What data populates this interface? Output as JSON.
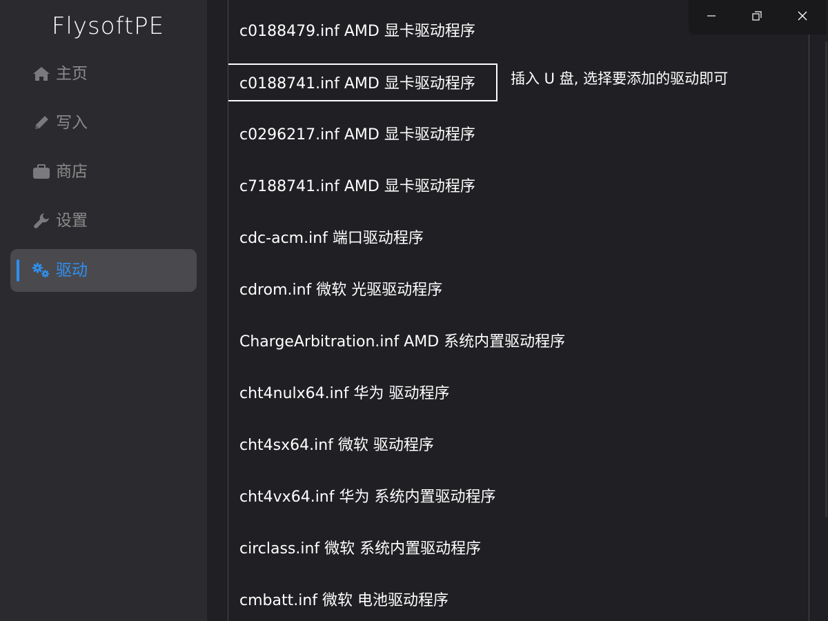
{
  "app": {
    "title": "FlysoftPE"
  },
  "sidebar": {
    "items": [
      {
        "label": "主页",
        "icon": "home-icon"
      },
      {
        "label": "写入",
        "icon": "pencil-icon"
      },
      {
        "label": "商店",
        "icon": "briefcase-icon"
      },
      {
        "label": "设置",
        "icon": "wrench-icon"
      },
      {
        "label": "驱动",
        "icon": "gears-icon",
        "active": true
      }
    ],
    "active_color": "#2f8ff0"
  },
  "drivers": {
    "items": [
      "c0188479.inf AMD 显卡驱动程序",
      "c0188741.inf AMD 显卡驱动程序",
      "c0296217.inf AMD 显卡驱动程序",
      "c7188741.inf AMD 显卡驱动程序",
      "cdc-acm.inf 端口驱动程序",
      "cdrom.inf 微软 光驱驱动程序",
      "ChargeArbitration.inf AMD 系统内置驱动程序",
      "cht4nulx64.inf 华为 驱动程序",
      "cht4sx64.inf 微软 驱动程序",
      "cht4vx64.inf 华为 系统内置驱动程序",
      "circlass.inf 微软 系统内置驱动程序",
      "cmbatt.inf 微软 电池驱动程序"
    ],
    "selected_index": 1
  },
  "hint": "插入 U 盘, 选择要添加的驱动即可",
  "window_controls": [
    "minimize-icon",
    "maximize-icon",
    "close-icon"
  ]
}
